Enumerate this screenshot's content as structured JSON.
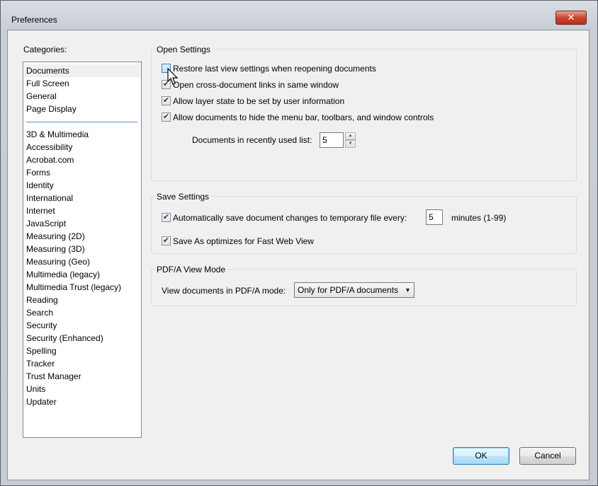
{
  "window": {
    "title": "Preferences",
    "close_glyph": "✕"
  },
  "categories": {
    "label": "Categories:",
    "top_items": [
      "Documents",
      "Full Screen",
      "General",
      "Page Display"
    ],
    "items": [
      "3D & Multimedia",
      "Accessibility",
      "Acrobat.com",
      "Forms",
      "Identity",
      "International",
      "Internet",
      "JavaScript",
      "Measuring (2D)",
      "Measuring (3D)",
      "Measuring (Geo)",
      "Multimedia (legacy)",
      "Multimedia Trust (legacy)",
      "Reading",
      "Search",
      "Security",
      "Security (Enhanced)",
      "Spelling",
      "Tracker",
      "Trust Manager",
      "Units",
      "Updater"
    ],
    "selected": "Documents"
  },
  "open_settings": {
    "title": "Open Settings",
    "options": [
      {
        "label": "Restore last view settings when reopening documents",
        "checked": false
      },
      {
        "label": "Open cross-document links in same window",
        "checked": true
      },
      {
        "label": "Allow layer state to be set by user information",
        "checked": true
      },
      {
        "label": "Allow documents to hide the menu bar, toolbars, and window controls",
        "checked": true
      }
    ],
    "recent_label": "Documents in recently used list:",
    "recent_value": "5"
  },
  "save_settings": {
    "title": "Save Settings",
    "autosave_label": "Automatically save document changes to temporary file every:",
    "autosave_checked": true,
    "autosave_value": "5",
    "autosave_unit": "minutes (1-99)",
    "fastweb_label": "Save As optimizes for Fast Web View",
    "fastweb_checked": true
  },
  "pdfa": {
    "title": "PDF/A View Mode",
    "mode_label": "View documents in PDF/A mode:",
    "mode_value": "Only for PDF/A documents"
  },
  "buttons": {
    "ok": "OK",
    "cancel": "Cancel"
  }
}
